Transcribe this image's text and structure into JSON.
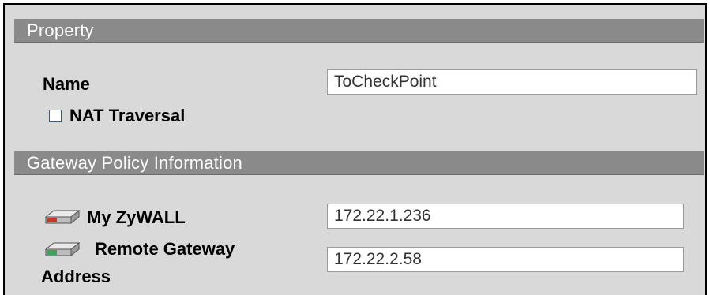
{
  "property": {
    "header": "Property",
    "name_label": "Name",
    "name_value": "ToCheckPoint",
    "nat_traversal_label": "NAT Traversal",
    "nat_traversal_checked": false
  },
  "gateway": {
    "header": "Gateway Policy Information",
    "my_zywall_label": "My ZyWALL",
    "my_zywall_value": "172.22.1.236",
    "my_zywall_icon": "router-red-icon",
    "remote_label_line1": "Remote Gateway",
    "remote_label_line2": "Address",
    "remote_value": "172.22.2.58",
    "remote_icon": "router-green-icon"
  },
  "colors": {
    "section_header_bg": "#8a8a8a",
    "panel_bg": "#d9d9d9",
    "my_zywall_accent": "#c0392b",
    "remote_accent": "#3fa35a"
  }
}
